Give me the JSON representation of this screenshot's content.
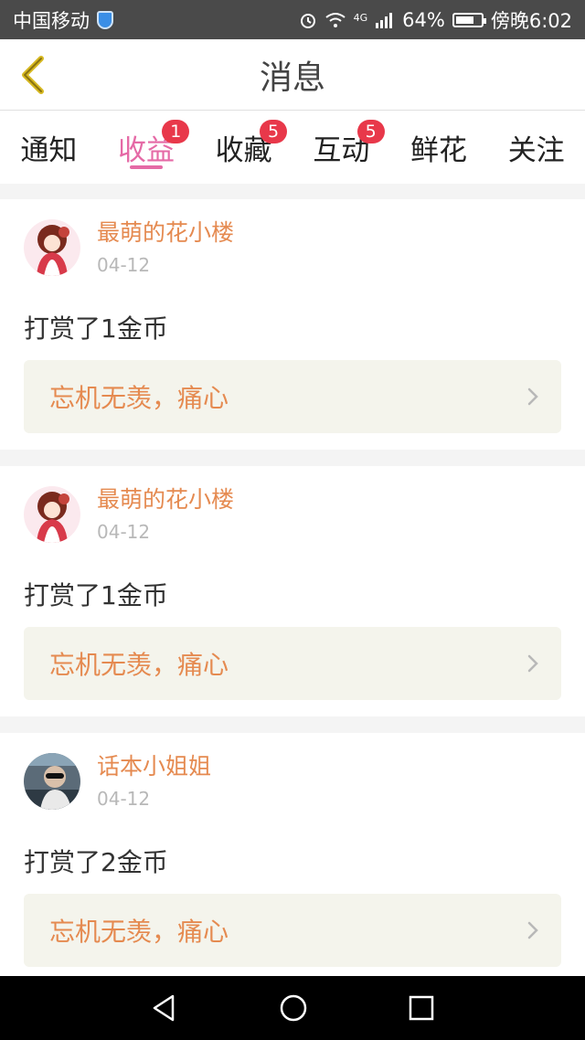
{
  "status_bar": {
    "carrier": "中国移动",
    "network": "4G",
    "battery": "64%",
    "time": "傍晚6:02",
    "icons": [
      "shield-icon",
      "alarm-icon",
      "wifi-icon",
      "signal-icon",
      "battery-icon"
    ]
  },
  "header": {
    "title": "消息",
    "back_icon": "chevron-left-icon",
    "back_color": "#d6b820"
  },
  "tabs": [
    {
      "label": "通知",
      "badge": ""
    },
    {
      "label": "收益",
      "badge": "1",
      "active": true
    },
    {
      "label": "收藏",
      "badge": "5"
    },
    {
      "label": "互动",
      "badge": "5"
    },
    {
      "label": "鲜花",
      "badge": ""
    },
    {
      "label": "关注",
      "badge": ""
    }
  ],
  "messages": [
    {
      "name": "最萌的花小楼",
      "date": "04-12",
      "action": "打赏了1金币",
      "quote": "忘机无羡，痛心"
    },
    {
      "name": "最萌的花小楼",
      "date": "04-12",
      "action": "打赏了1金币",
      "quote": "忘机无羡，痛心"
    },
    {
      "name": "话本小姐姐",
      "date": "04-12",
      "action": "打赏了2金币",
      "quote": "忘机无羡，痛心"
    }
  ],
  "colors": {
    "accent": "#e56aa6",
    "name": "#e58a50",
    "badge": "#e8384a"
  },
  "nav": {
    "icons": [
      "back-triangle-icon",
      "home-circle-icon",
      "recent-square-icon"
    ]
  }
}
